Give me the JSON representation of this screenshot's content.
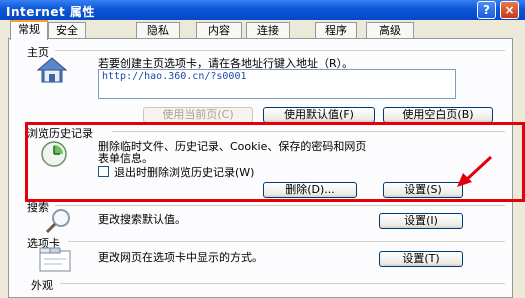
{
  "window": {
    "title": "Internet 属性",
    "help_glyph": "?",
    "close_glyph": "×"
  },
  "tabs": [
    "常规",
    "安全",
    "隐私",
    "内容",
    "连接",
    "程序",
    "高级"
  ],
  "home": {
    "section_label": "主页",
    "description": "若要创建主页选项卡，请在各地址行键入地址（R）。",
    "url": "http://hao.360.cn/?s0001",
    "btn_current": "使用当前页(C)",
    "btn_default": "使用默认值(F)",
    "btn_blank": "使用空白页(B)"
  },
  "history": {
    "section_label": "浏览历史记录",
    "description_line1": "删除临时文件、历史记录、Cookie、保存的密码和网页",
    "description_line2": "表单信息。",
    "checkbox_label": "退出时删除浏览历史记录(W)",
    "btn_delete": "删除(D)...",
    "btn_settings": "设置(S)"
  },
  "search": {
    "section_label": "搜索",
    "description": "更改搜索默认值。",
    "btn_settings": "设置(I)"
  },
  "tabs_section": {
    "section_label": "选项卡",
    "description": "更改网页在选项卡中显示的方式。",
    "btn_settings": "设置(T)"
  },
  "appearance": {
    "section_label": "外观"
  },
  "colors": {
    "highlight": "#e3000b",
    "titlebar": "#0a57d8",
    "link": "#1a4aa8"
  }
}
